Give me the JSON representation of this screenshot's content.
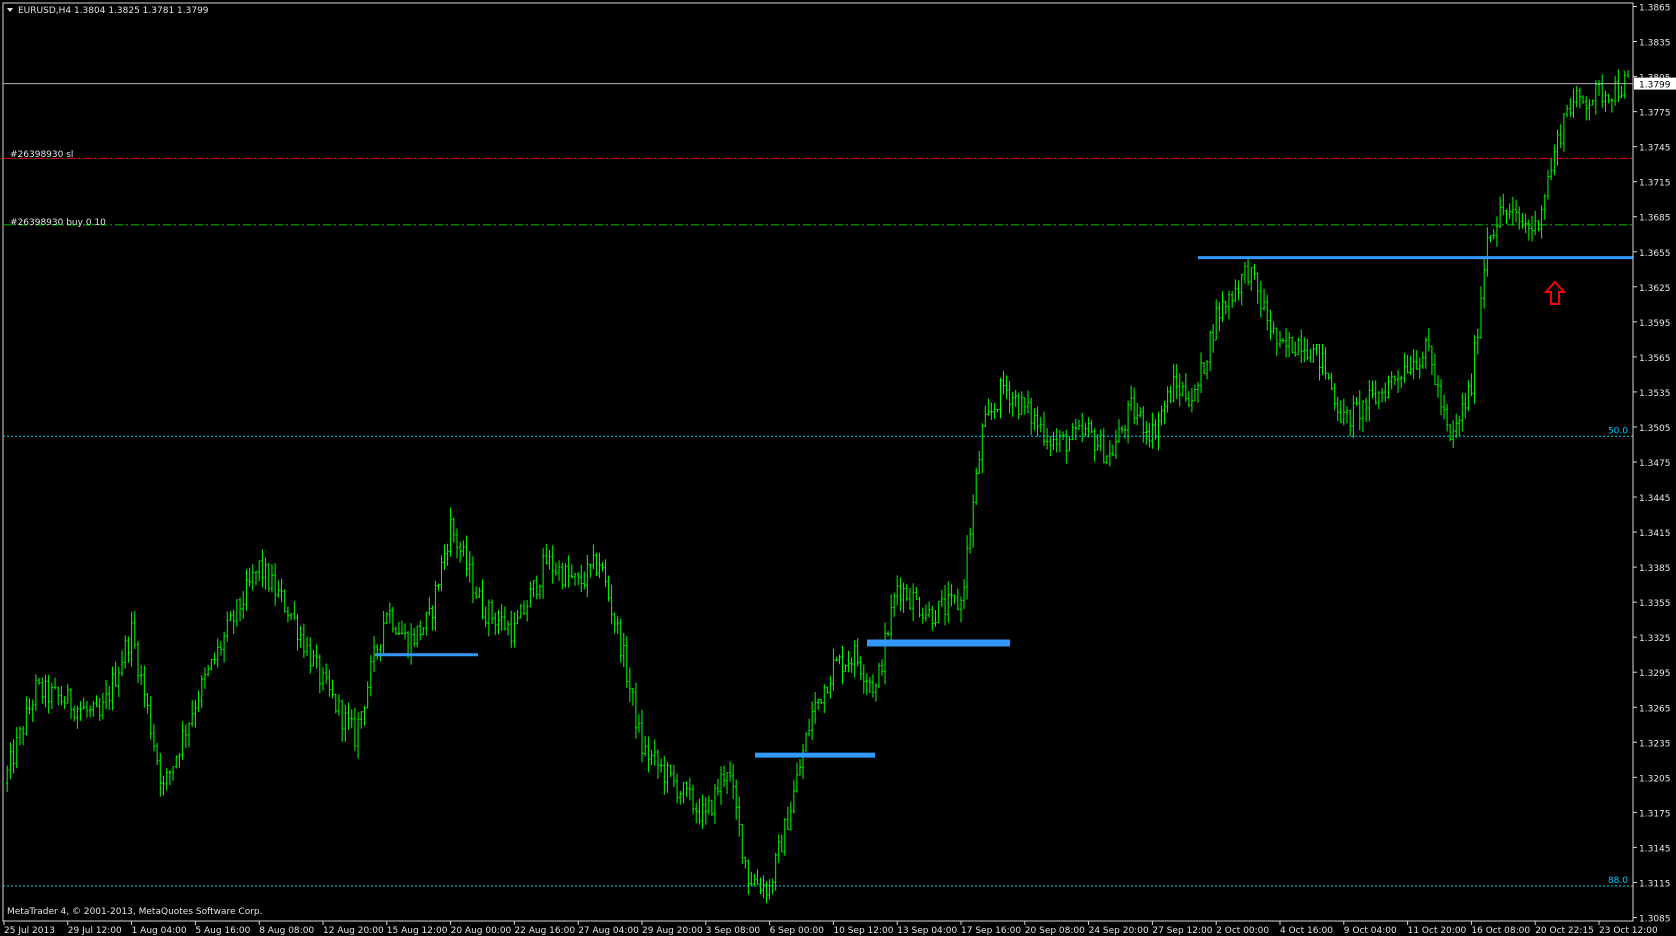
{
  "header": {
    "title": "EURUSD,H4  1.3804 1.3825 1.3781 1.3799",
    "menu_icon": "triangle-down-icon"
  },
  "footer": {
    "copyright": "MetaTrader 4, © 2001-2013, MetaQuotes Software Corp."
  },
  "colors": {
    "background": "#000000",
    "candles": "#00ff00",
    "levels": "#3399ff",
    "stop_loss": "#ff0000",
    "order": "#00c800",
    "fibo": "#00ccff",
    "bid_line": "#b4b4b4",
    "arrow": "#ff0000",
    "axis_text": "#e6e6e6"
  },
  "orders": {
    "stop_loss": {
      "label": "#26398930 sl",
      "price": 1.3735
    },
    "buy": {
      "label": "#26398930 buy 0.10",
      "price": 1.3678
    }
  },
  "fibo_levels": [
    {
      "label": "50.0",
      "price": 1.3497
    },
    {
      "label": "88.0",
      "price": 1.3112
    }
  ],
  "horizontal_levels": [
    {
      "price": 1.331,
      "from": "15 Aug 12:00",
      "to": "20 Aug 20:00"
    },
    {
      "price": 1.3224,
      "from": "3 Sep 20:00",
      "to": "10 Sep 12:00"
    },
    {
      "price": 1.332,
      "from": "10 Sep 12:00",
      "to": "17 Sep 16:00"
    },
    {
      "price": 1.365,
      "from": "27 Sep 16:00",
      "to": "23 Oct 16:00"
    }
  ],
  "arrow": {
    "icon": "up-arrow-icon",
    "time": "21 Oct 12:00",
    "price": 1.3625
  },
  "chart_data": {
    "type": "candlestick",
    "symbol": "EURUSD",
    "timeframe": "H4",
    "ohlc": {
      "open": 1.3804,
      "high": 1.3825,
      "low": 1.3781,
      "close": 1.3799
    },
    "current_price": 1.3799,
    "ylim": [
      1.3082,
      1.3868
    ],
    "y_ticks": [
      "1.3865",
      "1.3835",
      "1.3805",
      "1.3775",
      "1.3745",
      "1.3715",
      "1.3685",
      "1.3655",
      "1.3625",
      "1.3595",
      "1.3565",
      "1.3535",
      "1.3505",
      "1.3475",
      "1.3445",
      "1.3415",
      "1.3385",
      "1.3355",
      "1.3325",
      "1.3295",
      "1.3265",
      "1.3235",
      "1.3205",
      "1.3175",
      "1.3145",
      "1.3115",
      "1.3085"
    ],
    "x_ticks": [
      "25 Jul 2013",
      "29 Jul 12:00",
      "1 Aug 04:00",
      "5 Aug 16:00",
      "8 Aug 08:00",
      "12 Aug 20:00",
      "15 Aug 12:00",
      "20 Aug 00:00",
      "22 Aug 16:00",
      "27 Aug 04:00",
      "29 Aug 20:00",
      "3 Sep 08:00",
      "6 Sep 00:00",
      "10 Sep 12:00",
      "13 Sep 04:00",
      "17 Sep 16:00",
      "20 Sep 08:00",
      "24 Sep 20:00",
      "27 Sep 12:00",
      "2 Oct 00:00",
      "4 Oct 16:00",
      "9 Oct 04:00",
      "11 Oct 20:00",
      "16 Oct 08:00",
      "20 Oct 22:15",
      "23 Oct 12:00"
    ],
    "price_path": [
      [
        "25 Jul 2013",
        1.32
      ],
      [
        "26 Jul",
        1.328
      ],
      [
        "29 Jul 12:00",
        1.327
      ],
      [
        "31 Jul",
        1.3255
      ],
      [
        "1 Aug 04:00",
        1.333
      ],
      [
        "2 Aug",
        1.3195
      ],
      [
        "5 Aug 16:00",
        1.327
      ],
      [
        "7 Aug",
        1.333
      ],
      [
        "8 Aug 08:00",
        1.3385
      ],
      [
        "9 Aug",
        1.3345
      ],
      [
        "12 Aug 20:00",
        1.3285
      ],
      [
        "13 Aug",
        1.324
      ],
      [
        "15 Aug 12:00",
        1.335
      ],
      [
        "16 Aug",
        1.332
      ],
      [
        "19 Aug",
        1.334
      ],
      [
        "20 Aug 00:00",
        1.342
      ],
      [
        "21 Aug",
        1.335
      ],
      [
        "22 Aug 16:00",
        1.333
      ],
      [
        "23 Aug",
        1.339
      ],
      [
        "27 Aug 04:00",
        1.337
      ],
      [
        "27 Aug 16:00",
        1.339
      ],
      [
        "28 Aug",
        1.332
      ],
      [
        "29 Aug 20:00",
        1.323
      ],
      [
        "30 Aug",
        1.32
      ],
      [
        "3 Sep 08:00",
        1.317
      ],
      [
        "4 Sep",
        1.3215
      ],
      [
        "5 Sep",
        1.312
      ],
      [
        "6 Sep 00:00",
        1.311
      ],
      [
        "6 Sep 12:00",
        1.318
      ],
      [
        "9 Sep",
        1.326
      ],
      [
        "10 Sep 12:00",
        1.33
      ],
      [
        "11 Sep",
        1.331
      ],
      [
        "12 Sep",
        1.328
      ],
      [
        "13 Sep 04:00",
        1.337
      ],
      [
        "16 Sep",
        1.3345
      ],
      [
        "17 Sep 16:00",
        1.3355
      ],
      [
        "18 Sep",
        1.35
      ],
      [
        "19 Sep",
        1.354
      ],
      [
        "20 Sep 08:00",
        1.352
      ],
      [
        "23 Sep",
        1.349
      ],
      [
        "24 Sep 20:00",
        1.35
      ],
      [
        "25 Sep",
        1.348
      ],
      [
        "26 Sep",
        1.352
      ],
      [
        "27 Sep 12:00",
        1.35
      ],
      [
        "30 Sep",
        1.354
      ],
      [
        "1 Oct",
        1.353
      ],
      [
        "2 Oct 00:00",
        1.36
      ],
      [
        "3 Oct",
        1.364
      ],
      [
        "4 Oct 16:00",
        1.357
      ],
      [
        "7 Oct",
        1.358
      ],
      [
        "8 Oct",
        1.356
      ],
      [
        "9 Oct 04:00",
        1.351
      ],
      [
        "10 Oct",
        1.353
      ],
      [
        "11 Oct 20:00",
        1.356
      ],
      [
        "14 Oct",
        1.357
      ],
      [
        "15 Oct",
        1.349
      ],
      [
        "16 Oct 08:00",
        1.354
      ],
      [
        "17 Oct",
        1.367
      ],
      [
        "18 Oct",
        1.369
      ],
      [
        "21 Oct",
        1.368
      ],
      [
        "20 Oct 22:15",
        1.3675
      ],
      [
        "22 Oct",
        1.378
      ],
      [
        "23 Oct 12:00",
        1.379
      ],
      [
        "24 Oct",
        1.3799
      ]
    ]
  }
}
